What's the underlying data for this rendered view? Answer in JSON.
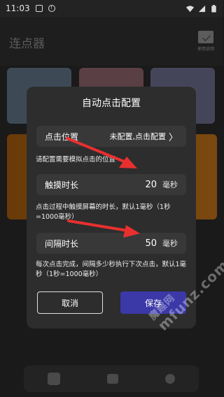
{
  "status_bar": {
    "time": "11:03"
  },
  "app": {
    "title": "连点器",
    "manual_label": "使用说明"
  },
  "dialog": {
    "title": "自动点击配置",
    "position_row": {
      "label": "点击位置",
      "status": "未配置,点击配置",
      "chevron": "〉"
    },
    "position_hint": "请配置需要模拟点击的位置",
    "touch_row": {
      "label": "触摸时长",
      "value": "20",
      "unit": "毫秒"
    },
    "touch_hint": "点击过程中触摸屏幕的时长，默认1毫秒（1秒=1000毫秒）",
    "interval_row": {
      "label": "间隔时长",
      "value": "50",
      "unit": "毫秒"
    },
    "interval_hint": "每次点击完成，间隔多少秒执行下次点击，默认1毫秒（1秒=1000毫秒）",
    "cancel_label": "取消",
    "save_label": "保存"
  },
  "watermark": {
    "brand": "魔趣网",
    "url": "mfunz.com"
  },
  "colors": {
    "dialog_bg": "#2d2d2d",
    "row_bg": "#383838",
    "save_button": "#3b38a8",
    "arrow": "#e8302f",
    "orange_card": "#7a4810"
  },
  "icons": {
    "manual": "envelope-icon",
    "bottom_bar": [
      "cursor-icon",
      "camera-icon",
      "person-icon"
    ]
  }
}
